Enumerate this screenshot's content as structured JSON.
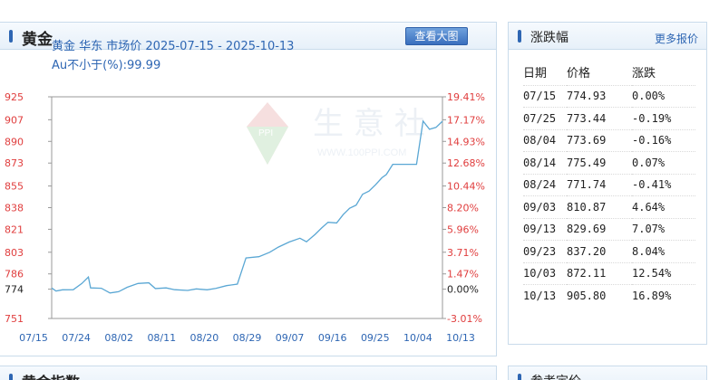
{
  "left": {
    "title": "黄金",
    "big_button": "查看大图",
    "subtitle_line1": "黄金 华东 市场价 2025-07-15 - 2025-10-13",
    "subtitle_line2": "Au不小于(%):99.99"
  },
  "watermark": {
    "text": "生 意 社",
    "url": "WWW.100PPI.COM",
    "logo": "PPI"
  },
  "chart_data": {
    "type": "line",
    "x_ticks": [
      "07/15",
      "07/24",
      "08/02",
      "08/11",
      "08/20",
      "08/29",
      "09/07",
      "09/16",
      "09/25",
      "10/04",
      "10/13"
    ],
    "y_left_ticks": [
      "925",
      "907",
      "890",
      "873",
      "855",
      "838",
      "821",
      "803",
      "786",
      "774",
      "751"
    ],
    "y_right_ticks": [
      "19.41%",
      "17.17%",
      "14.93%",
      "12.68%",
      "10.44%",
      "8.20%",
      "5.96%",
      "3.71%",
      "1.47%",
      "0.00%",
      "-3.01%"
    ],
    "ylim": [
      751,
      925
    ],
    "series": [
      {
        "color": "#5aa7d4",
        "points": [
          [
            0,
            774.9
          ],
          [
            2,
            772.5
          ],
          [
            5,
            773.5
          ],
          [
            10,
            773.6
          ],
          [
            14,
            778.5
          ],
          [
            17,
            783.5
          ],
          [
            18,
            775.0
          ],
          [
            23,
            774.7
          ],
          [
            27,
            771.0
          ],
          [
            31,
            772.0
          ],
          [
            35,
            775.5
          ],
          [
            40,
            778.5
          ],
          [
            45,
            779.0
          ],
          [
            48,
            774.5
          ],
          [
            53,
            775.0
          ],
          [
            57,
            773.6
          ],
          [
            63,
            773.0
          ],
          [
            67,
            774.2
          ],
          [
            72,
            773.5
          ],
          [
            76,
            774.6
          ],
          [
            81,
            776.8
          ],
          [
            86,
            778.0
          ],
          [
            90,
            798.5
          ],
          [
            96,
            799.5
          ],
          [
            101,
            803.0
          ],
          [
            105,
            807.0
          ],
          [
            110,
            811.0
          ],
          [
            115,
            814.0
          ],
          [
            118,
            811.2
          ],
          [
            122,
            817.0
          ],
          [
            125,
            822.0
          ],
          [
            128,
            826.5
          ],
          [
            132,
            826.0
          ],
          [
            135,
            832.5
          ],
          [
            138,
            837.5
          ],
          [
            141,
            840.0
          ],
          [
            144,
            848.5
          ],
          [
            147,
            851.0
          ],
          [
            150,
            856.0
          ],
          [
            153,
            861.5
          ],
          [
            155,
            864.0
          ],
          [
            158,
            872.0
          ],
          [
            165,
            872.0
          ],
          [
            169,
            872.0
          ],
          [
            172,
            906.0
          ],
          [
            175,
            899.5
          ],
          [
            178,
            901.0
          ],
          [
            181,
            905.8
          ]
        ]
      }
    ]
  },
  "right": {
    "title": "涨跌幅",
    "more": "更多报价",
    "headers": [
      "日期",
      "价格",
      "涨跌"
    ],
    "rows": [
      {
        "date": "07/15",
        "price": "774.93",
        "change": "0.00%",
        "dir": "zero"
      },
      {
        "date": "07/25",
        "price": "773.44",
        "change": "-0.19%",
        "dir": "down"
      },
      {
        "date": "08/04",
        "price": "773.69",
        "change": "-0.16%",
        "dir": "down"
      },
      {
        "date": "08/14",
        "price": "775.49",
        "change": "0.07%",
        "dir": "up"
      },
      {
        "date": "08/24",
        "price": "771.74",
        "change": "-0.41%",
        "dir": "down"
      },
      {
        "date": "09/03",
        "price": "810.87",
        "change": "4.64%",
        "dir": "up"
      },
      {
        "date": "09/13",
        "price": "829.69",
        "change": "7.07%",
        "dir": "up"
      },
      {
        "date": "09/23",
        "price": "837.20",
        "change": "8.04%",
        "dir": "up"
      },
      {
        "date": "10/03",
        "price": "872.11",
        "change": "12.54%",
        "dir": "up"
      },
      {
        "date": "10/13",
        "price": "905.80",
        "change": "16.89%",
        "dir": "up"
      }
    ]
  },
  "bottom": {
    "left_title": "黄金指数",
    "right_title": "参考定价"
  }
}
